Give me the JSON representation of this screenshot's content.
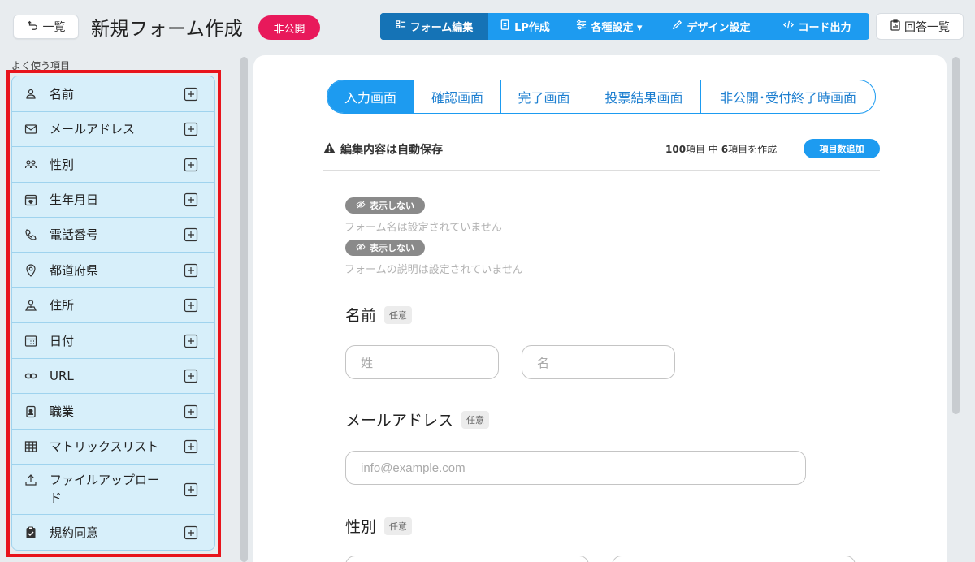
{
  "header": {
    "back_label": "一覧",
    "title": "新規フォーム作成",
    "status": "非公開",
    "tabs": [
      {
        "label": "フォーム編集",
        "icon": "form-edit-icon"
      },
      {
        "label": "LP作成",
        "icon": "lp-page-icon"
      },
      {
        "label": "各種設定 ▾",
        "icon": "sliders-icon"
      },
      {
        "label": "デザイン設定",
        "icon": "pen-icon"
      },
      {
        "label": "コード出力",
        "icon": "code-icon"
      }
    ],
    "answers_label": "回答一覧"
  },
  "sidebar": {
    "heading": "よく使う項目",
    "items": [
      {
        "label": "名前",
        "icon": "person-icon"
      },
      {
        "label": "メールアドレス",
        "icon": "envelope-icon"
      },
      {
        "label": "性別",
        "icon": "people-icon"
      },
      {
        "label": "生年月日",
        "icon": "calendar-heart-icon"
      },
      {
        "label": "電話番号",
        "icon": "phone-icon"
      },
      {
        "label": "都道府県",
        "icon": "location-pin-icon"
      },
      {
        "label": "住所",
        "icon": "map-person-icon"
      },
      {
        "label": "日付",
        "icon": "calendar-icon"
      },
      {
        "label": "URL",
        "icon": "link-icon"
      },
      {
        "label": "職業",
        "icon": "badge-icon"
      },
      {
        "label": "マトリックスリスト",
        "icon": "table-icon"
      },
      {
        "label": "ファイルアップロード",
        "icon": "upload-icon"
      },
      {
        "label": "規約同意",
        "icon": "clipboard-check-icon"
      }
    ]
  },
  "screen_tabs": [
    "入力画面",
    "確認画面",
    "完了画面",
    "投票結果画面",
    "非公開･受付終了時画面"
  ],
  "editor": {
    "autosave": "編集内容は自動保存",
    "count_total": "100",
    "count_mid": "項目 中 ",
    "count_made": "6",
    "count_suffix": "項目を作成",
    "add_items": "項目数追加",
    "hidden_chip": "表示しない",
    "form_name_note": "フォーム名は設定されていません",
    "form_desc_note": "フォームの説明は設定されていません",
    "optional_tag": "任意",
    "fields": {
      "name_label": "名前",
      "last_name_placeholder": "姓",
      "first_name_placeholder": "名",
      "email_label": "メールアドレス",
      "email_placeholder": "info@example.com",
      "gender_label": "性別"
    }
  },
  "colors": {
    "accent": "#1d9bf0",
    "accent_dark": "#1573b6",
    "status_red": "#e8195b",
    "palette_bg": "#d7effa",
    "highlight_border": "#e8141c"
  }
}
